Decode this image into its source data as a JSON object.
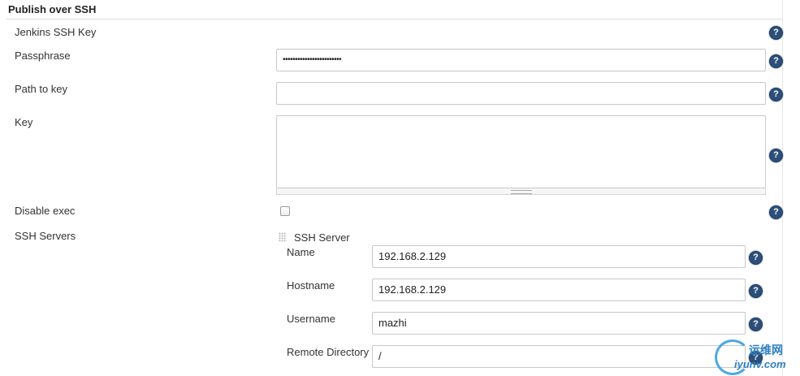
{
  "section": {
    "title": "Publish over SSH"
  },
  "fields": {
    "jenkins_ssh_key": {
      "label": "Jenkins SSH Key"
    },
    "passphrase": {
      "label": "Passphrase",
      "value": "••••••••••••••••••••••••"
    },
    "path_to_key": {
      "label": "Path to key",
      "value": ""
    },
    "key": {
      "label": "Key",
      "value": ""
    },
    "disable_exec": {
      "label": "Disable exec",
      "checked": false
    }
  },
  "ssh_servers": {
    "label": "SSH Servers",
    "server": {
      "heading": "SSH Server",
      "name": {
        "label": "Name",
        "value": "192.168.2.129"
      },
      "hostname": {
        "label": "Hostname",
        "value": "192.168.2.129"
      },
      "username": {
        "label": "Username",
        "value": "mazhi"
      },
      "remote_directory": {
        "label": "Remote Directory",
        "value": "/"
      }
    }
  },
  "help_icon": {
    "glyph": "?"
  },
  "watermark": {
    "cn": "运维网",
    "en": "iyunv.com"
  }
}
